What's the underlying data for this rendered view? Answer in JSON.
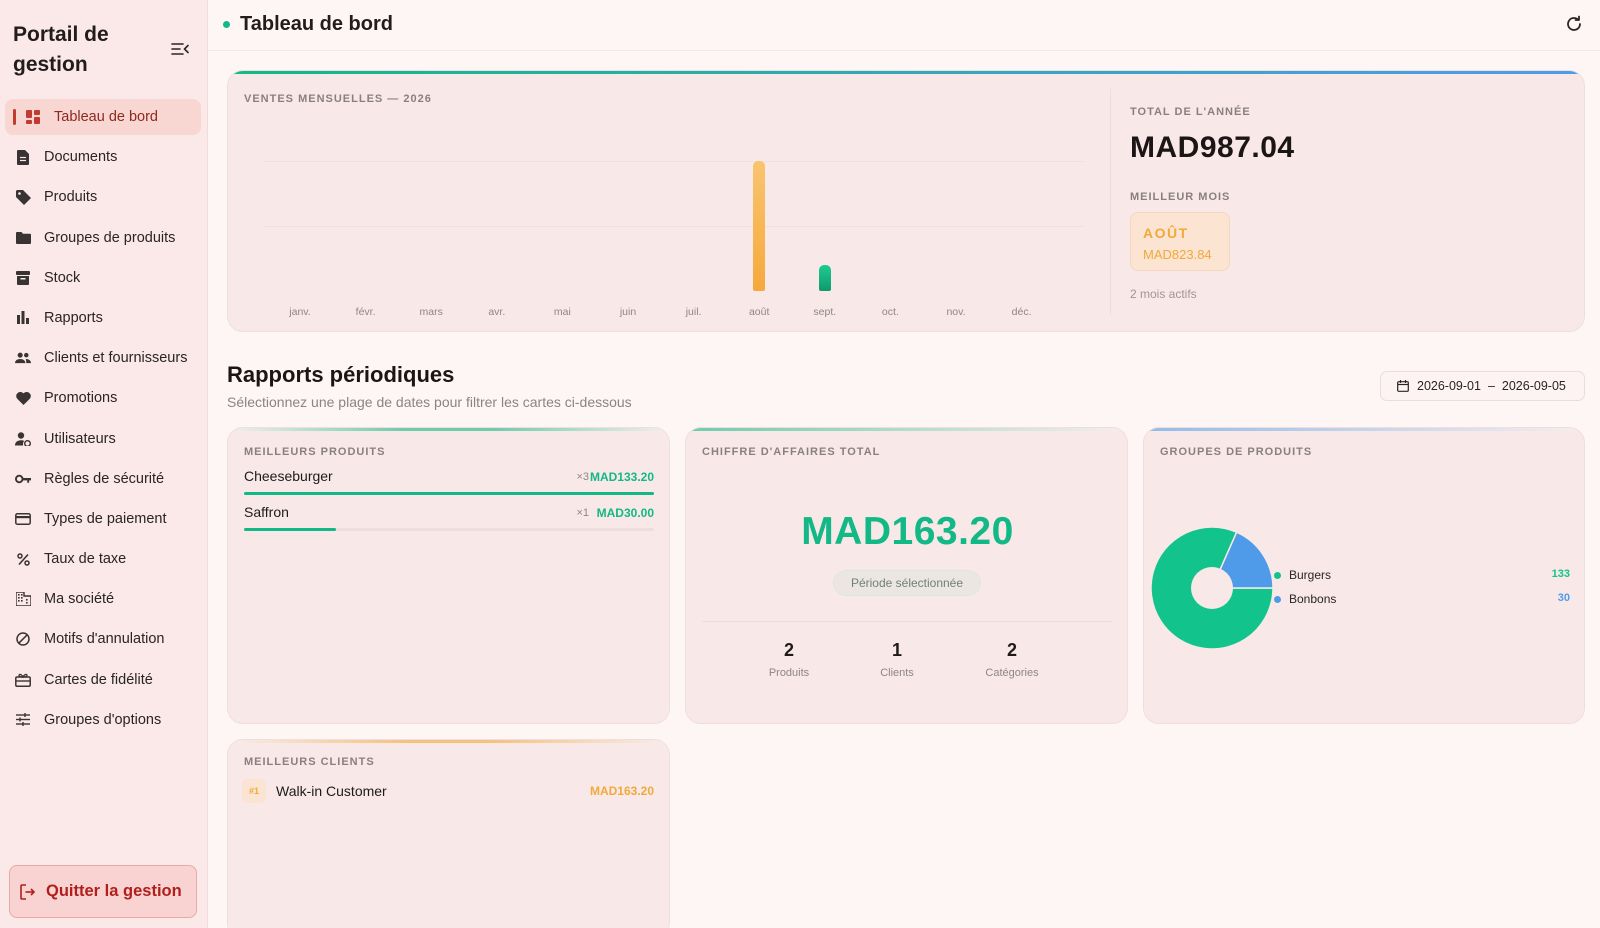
{
  "sidebar": {
    "brand": "Portail de gestion",
    "items": [
      {
        "label": "Tableau de bord",
        "icon": "dashboard-icon",
        "active": true
      },
      {
        "label": "Documents",
        "icon": "document-icon"
      },
      {
        "label": "Produits",
        "icon": "tag-icon"
      },
      {
        "label": "Groupes de produits",
        "icon": "folder-icon"
      },
      {
        "label": "Stock",
        "icon": "archive-icon"
      },
      {
        "label": "Rapports",
        "icon": "bar-chart-icon"
      },
      {
        "label": "Clients et fournisseurs",
        "icon": "people-icon"
      },
      {
        "label": "Promotions",
        "icon": "heart-icon"
      },
      {
        "label": "Utilisateurs",
        "icon": "user-settings-icon"
      },
      {
        "label": "Règles de sécurité",
        "icon": "key-icon"
      },
      {
        "label": "Types de paiement",
        "icon": "credit-card-icon"
      },
      {
        "label": "Taux de taxe",
        "icon": "percent-icon"
      },
      {
        "label": "Ma société",
        "icon": "building-icon"
      },
      {
        "label": "Motifs d'annulation",
        "icon": "cancel-icon"
      },
      {
        "label": "Cartes de fidélité",
        "icon": "gift-card-icon"
      },
      {
        "label": "Groupes d'options",
        "icon": "sliders-icon"
      }
    ],
    "quit_label": "Quitter la gestion"
  },
  "header": {
    "title": "Tableau de bord"
  },
  "sales": {
    "label": "VENTES MENSUELLES — 2026",
    "total_label": "TOTAL DE L'ANNÉE",
    "total_value": "MAD987.04",
    "best_label": "MEILLEUR MOIS",
    "best_month": "AOÛT",
    "best_amount": "MAD823.84",
    "active_months": "2 mois actifs"
  },
  "chart_data": {
    "type": "bar",
    "categories": [
      "janv.",
      "févr.",
      "mars",
      "avr.",
      "mai",
      "juin",
      "juil.",
      "août",
      "sept.",
      "oct.",
      "nov.",
      "déc."
    ],
    "values": [
      0,
      0,
      0,
      0,
      0,
      0,
      0,
      823.84,
      163.2,
      0,
      0,
      0
    ],
    "title": "VENTES MENSUELLES — 2026",
    "bar_colors": {
      "août": "#f6b24f",
      "sept.": "#12b886"
    },
    "grid": true
  },
  "periodic": {
    "title": "Rapports périodiques",
    "subtitle": "Sélectionnez une plage de dates pour filtrer les cartes ci-dessous",
    "date_from": "2026-09-01",
    "date_sep": "–",
    "date_to": "2026-09-05"
  },
  "best_products": {
    "label": "MEILLEURS PRODUITS",
    "items": [
      {
        "name": "Cheeseburger",
        "qty": "×3",
        "amount": "MAD133.20",
        "share": 1.0
      },
      {
        "name": "Saffron",
        "qty": "×1",
        "amount": "MAD30.00",
        "share": 0.225
      }
    ]
  },
  "revenue": {
    "label": "CHIFFRE D'AFFAIRES TOTAL",
    "value": "MAD163.20",
    "pill": "Période sélectionnée",
    "stats": [
      {
        "num": "2",
        "label": "Produits"
      },
      {
        "num": "1",
        "label": "Clients"
      },
      {
        "num": "2",
        "label": "Catégories"
      }
    ]
  },
  "groups": {
    "label": "GROUPES DE PRODUITS",
    "items": [
      {
        "name": "Burgers",
        "value": "133",
        "amount": 133.2,
        "color": "#12c48b"
      },
      {
        "name": "Bonbons",
        "value": "30",
        "amount": 30,
        "color": "#4f9bea"
      }
    ]
  },
  "best_clients": {
    "label": "MEILLEURS CLIENTS",
    "items": [
      {
        "rank": "#1",
        "name": "Walk-in Customer",
        "amount": "MAD163.20"
      }
    ]
  },
  "colors": {
    "accent_green": "#12b886",
    "accent_orange": "#f2a93b",
    "accent_blue": "#4f9bea",
    "danger": "#b01f1b"
  }
}
